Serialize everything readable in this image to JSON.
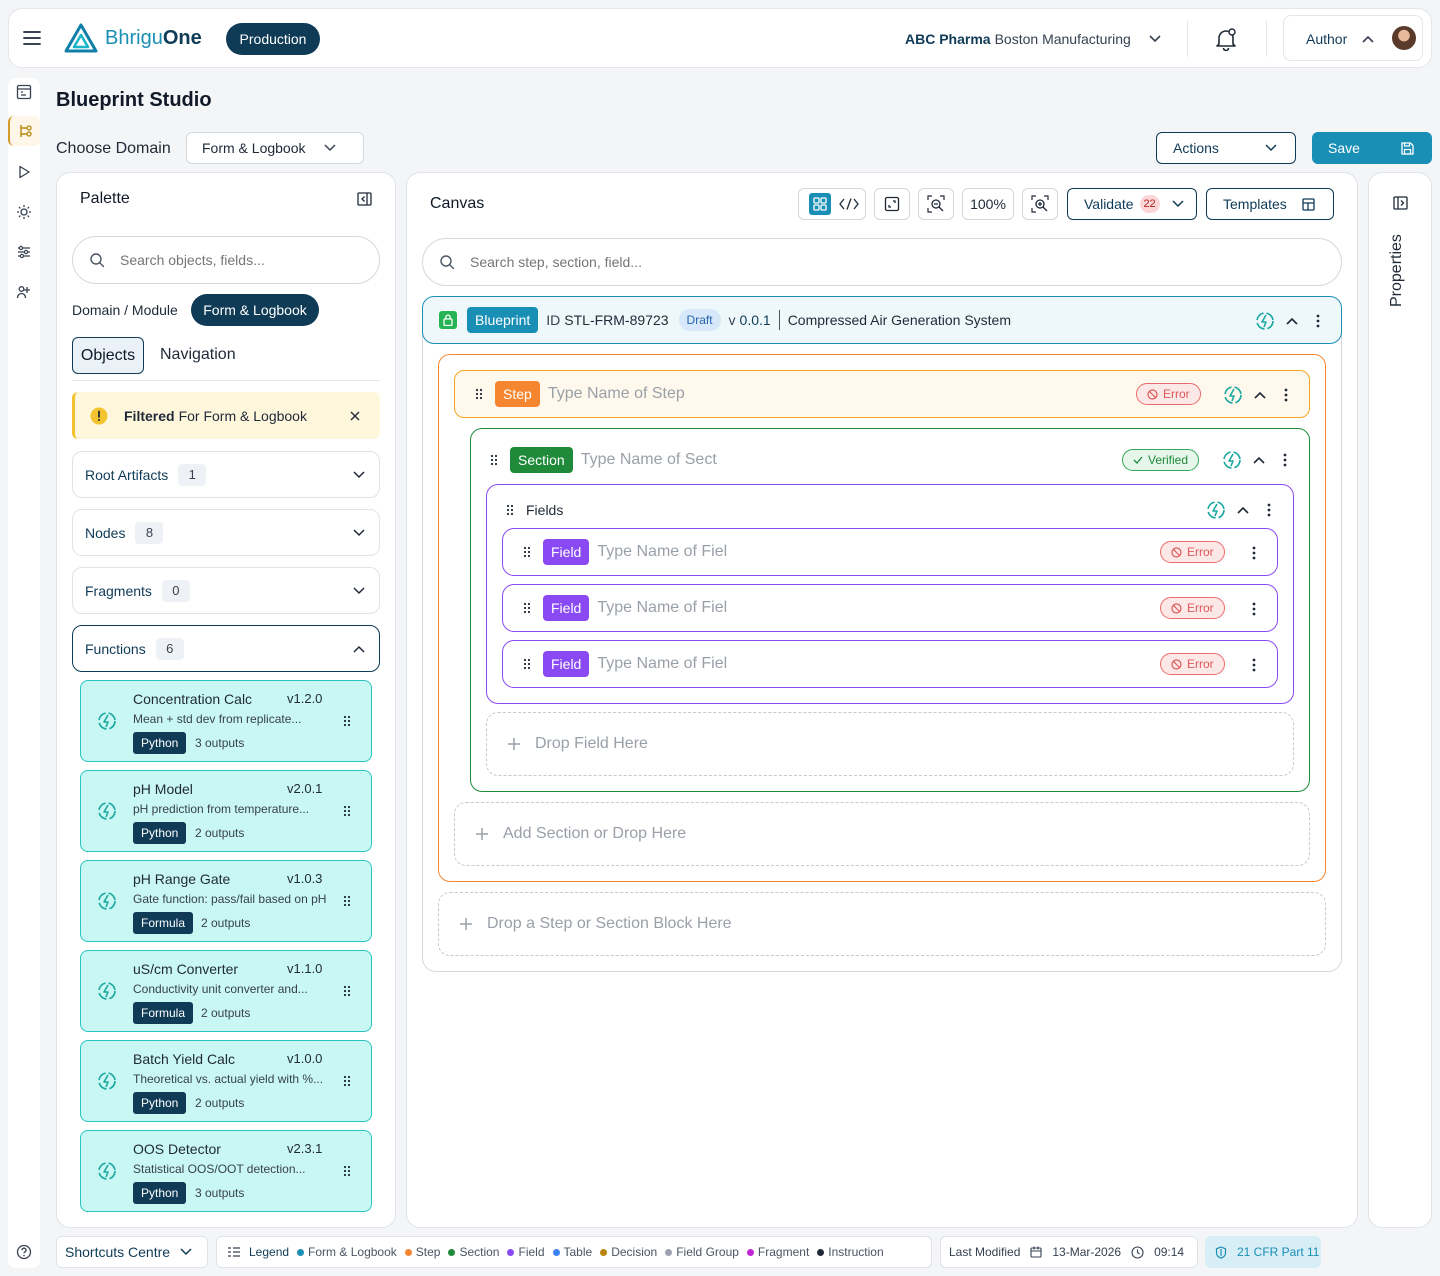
{
  "header": {
    "brand_part1": "Bhrigu",
    "brand_part2": "One",
    "env_badge": "Production",
    "org_name_bold": "ABC Pharma",
    "org_site": "Boston Manufacturing",
    "role": "Author"
  },
  "page": {
    "title": "Blueprint Studio",
    "choose_domain_label": "Choose Domain",
    "domain_value": "Form & Logbook",
    "actions_label": "Actions",
    "save_label": "Save"
  },
  "palette": {
    "title": "Palette",
    "search_placeholder": "Search objects, fields...",
    "domain_module_label": "Domain / Module",
    "domain_module_value": "Form & Logbook",
    "tabs": [
      {
        "label": "Objects"
      },
      {
        "label": "Navigation"
      }
    ],
    "filter_bold": "Filtered",
    "filter_rest": "For Form & Logbook",
    "groups": [
      {
        "label": "Root Artifacts",
        "count": "1"
      },
      {
        "label": "Nodes",
        "count": "8"
      },
      {
        "label": "Fragments",
        "count": "0"
      },
      {
        "label": "Functions",
        "count": "6"
      }
    ],
    "functions": [
      {
        "name": "Concentration Calc",
        "version": "v1.2.0",
        "desc": "Mean + std dev from replicate...",
        "lang": "Python",
        "outputs": "3 outputs"
      },
      {
        "name": "pH Model",
        "version": "v2.0.1",
        "desc": "pH prediction from temperature...",
        "lang": "Python",
        "outputs": "2 outputs"
      },
      {
        "name": "pH Range Gate",
        "version": "v1.0.3",
        "desc": "Gate function: pass/fail based on pH",
        "lang": "Formula",
        "outputs": "2 outputs"
      },
      {
        "name": "uS/cm Converter",
        "version": "v1.1.0",
        "desc": "Conductivity unit converter and...",
        "lang": "Formula",
        "outputs": "2 outputs"
      },
      {
        "name": "Batch Yield Calc",
        "version": "v1.0.0",
        "desc": "Theoretical vs. actual yield with %...",
        "lang": "Python",
        "outputs": "2 outputs"
      },
      {
        "name": "OOS Detector",
        "version": "v2.3.1",
        "desc": "Statistical OOS/OOT detection...",
        "lang": "Python",
        "outputs": "3 outputs"
      }
    ]
  },
  "canvas": {
    "title": "Canvas",
    "zoom": "100%",
    "validate_label": "Validate",
    "validate_count": "22",
    "templates_label": "Templates",
    "search_placeholder": "Search step, section, field...",
    "blueprint": {
      "tag": "Blueprint",
      "id_label": "ID",
      "id_value": "STL-FRM-89723",
      "status": "Draft",
      "version_prefix": "v",
      "version": "0.0.1",
      "system": "Compressed Air Generation System"
    },
    "step": {
      "tag": "Step",
      "placeholder": "Type Name of Step",
      "status": "Error"
    },
    "section": {
      "tag": "Section",
      "placeholder": "Type Name of Sect",
      "status": "Verified"
    },
    "fields_group": {
      "label": "Fields"
    },
    "fields": [
      {
        "tag": "Field",
        "placeholder": "Type Name of Fiel",
        "status": "Error"
      },
      {
        "tag": "Field",
        "placeholder": "Type Name of Fiel",
        "status": "Error"
      },
      {
        "tag": "Field",
        "placeholder": "Type Name of Fiel",
        "status": "Error"
      }
    ],
    "drop_field": "Drop Field Here",
    "add_section": "Add Section or Drop Here",
    "drop_step": "Drop a Step or Section Block Here"
  },
  "properties": {
    "label": "Properties"
  },
  "footer": {
    "shortcuts": "Shortcuts Centre",
    "legend_label": "Legend",
    "legend": [
      {
        "label": "Form & Logbook",
        "color": "#1a8fb5"
      },
      {
        "label": "Step",
        "color": "#f5862f"
      },
      {
        "label": "Section",
        "color": "#1e8a3a"
      },
      {
        "label": "Field",
        "color": "#8a4af3"
      },
      {
        "label": "Table",
        "color": "#3b82f6"
      },
      {
        "label": "Decision",
        "color": "#b8860b"
      },
      {
        "label": "Field Group",
        "color": "#9ca3af"
      },
      {
        "label": "Fragment",
        "color": "#c026d3"
      },
      {
        "label": "Instruction",
        "color": "#1f2937"
      }
    ],
    "last_modified_label": "Last Modified",
    "date": "13-Mar-2026",
    "time": "09:14",
    "compliance": "21 CFR Part 11"
  }
}
